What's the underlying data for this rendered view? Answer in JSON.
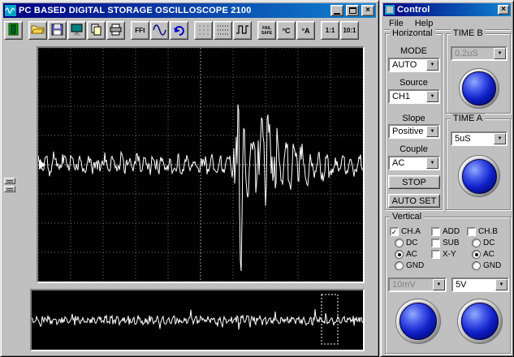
{
  "colors": {
    "titlebar_start": "#000080",
    "titlebar_end": "#1084d0",
    "knob_blue": "#1020c8",
    "trace": "#ffffff",
    "display_background": "#000000"
  },
  "main_window": {
    "title": "PC BASED DIGITAL STORAGE OSCILLOSCOPE 2100",
    "toolbar": {
      "fft": "FFt",
      "fail_line1": "FAIL",
      "fail_line2": "SAFE",
      "celsius": "°C",
      "ampere": "°A",
      "ratio_1_1": "1:1",
      "ratio_10_1": "10:1"
    }
  },
  "control_window": {
    "title": "Control",
    "menu": {
      "file": "File",
      "help": "Help"
    },
    "horizontal": {
      "label": "Horizontal",
      "mode_label": "MODE",
      "mode_value": "AUTO",
      "source_label": "Source",
      "source_value": "CH1",
      "slope_label": "Slope",
      "slope_value": "Positive",
      "couple_label": "Couple",
      "couple_value": "AC",
      "stop_button": "STOP",
      "auto_set_button": "AUTO SET"
    },
    "time_b": {
      "label": "TIME B",
      "value": "0.2uS"
    },
    "time_a": {
      "label": "TIME A",
      "value": "5uS"
    },
    "vertical": {
      "label": "Vertical",
      "ch_a": "CH.A",
      "add": "ADD",
      "ch_b": "CH.B",
      "dc_a": "DC",
      "sub": "SUB",
      "dc_b": "DC",
      "ac_a": "AC",
      "xy": "X-Y",
      "ac_b": "AC",
      "gnd_a": "GND",
      "gnd_b": "GND",
      "volt_a": "10mV",
      "volt_b": "5V"
    }
  },
  "scope": {
    "grid": {
      "cols": 10,
      "rows": 8
    },
    "main_trace": {
      "color": "#ffffff",
      "noise_amp": 12,
      "carrier_freq": 0.62,
      "burst_center": 0.625,
      "burst_amp": 128,
      "burst2_center": 0.7,
      "burst2_amp": 62,
      "tail_center": 0.79,
      "tail_amp": 22
    },
    "zoom_trace": {
      "color": "#ffffff",
      "noise_amp": 4,
      "spike_threshold": 0.93,
      "spike_amp": 10
    },
    "selection_box": {
      "x_frac": 0.875,
      "w_frac": 0.05
    }
  }
}
